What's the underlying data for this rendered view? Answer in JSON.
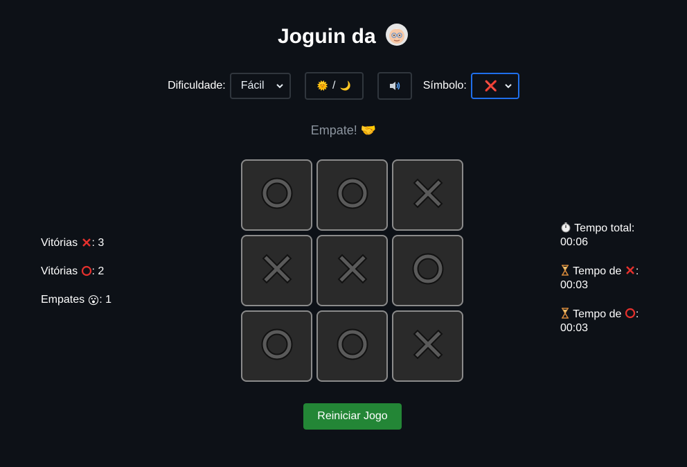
{
  "title": "Joguin da",
  "title_icon": "grandma-emoji",
  "controls": {
    "difficulty_label": "Dificuldade:",
    "difficulty_value": "Fácil",
    "theme_toggle": {
      "sun": "🌞",
      "separator": "/",
      "moon": "🌙"
    },
    "sound_icon": "speaker-icon",
    "symbol_label": "Símbolo:",
    "symbol_value": "❌"
  },
  "status": "Empate! 🤝",
  "board": [
    "O",
    "O",
    "X",
    "X",
    "X",
    "O",
    "O",
    "O",
    "X"
  ],
  "stats": {
    "wins_x_label": "Vitórias",
    "wins_x_value": ": 3",
    "wins_o_label": "Vitórias",
    "wins_o_value": ": 2",
    "draws_label": "Empates",
    "draws_icon": "😮",
    "draws_value": ": 1"
  },
  "timers": {
    "total_label": "Tempo total:",
    "total_value": "00:06",
    "x_label": "Tempo de",
    "x_value": "00:03",
    "o_label": "Tempo de",
    "o_value": "00:03"
  },
  "reset_label": "Reiniciar Jogo",
  "colors": {
    "background": "#0d1117",
    "accent_green": "#238636",
    "select_focus": "#1f6feb",
    "x_red": "#e5312d",
    "o_red": "#e5312d"
  }
}
